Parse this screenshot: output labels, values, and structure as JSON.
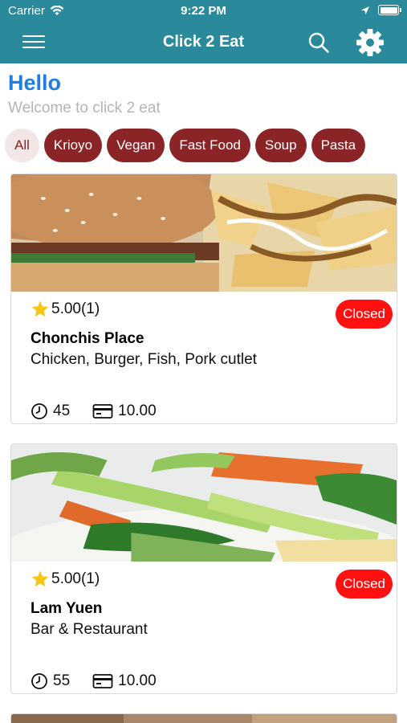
{
  "status_bar": {
    "carrier": "Carrier",
    "time": "9:22 PM"
  },
  "header": {
    "title": "Click 2 Eat"
  },
  "greeting": {
    "title": "Hello",
    "subtitle": "Welcome to click 2 eat"
  },
  "categories": [
    {
      "label": "All",
      "active": true
    },
    {
      "label": "Krioyo"
    },
    {
      "label": "Vegan"
    },
    {
      "label": "Fast Food"
    },
    {
      "label": "Soup"
    },
    {
      "label": "Pasta"
    }
  ],
  "restaurants": [
    {
      "rating": "5.00(1)",
      "status": "Closed",
      "name": "Chonchis Place",
      "cuisines": "Chicken, Burger, Fish, Pork cutlet",
      "time": "45",
      "min_order": "10.00",
      "photo": "burger-and-fries-photo"
    },
    {
      "rating": "5.00(1)",
      "status": "Closed",
      "name": "Lam Yuen",
      "cuisines": "Bar & Restaurant",
      "time": "55",
      "min_order": "10.00",
      "photo": "vegetable-stir-fry-photo"
    }
  ],
  "colors": {
    "header_bg": "#2a8a9b",
    "accent_blue": "#1e7fe0",
    "chip_bg": "#8b2426",
    "chip_active_bg": "#f2e6e6",
    "closed_badge": "#ff1111",
    "star": "#f5c518"
  }
}
